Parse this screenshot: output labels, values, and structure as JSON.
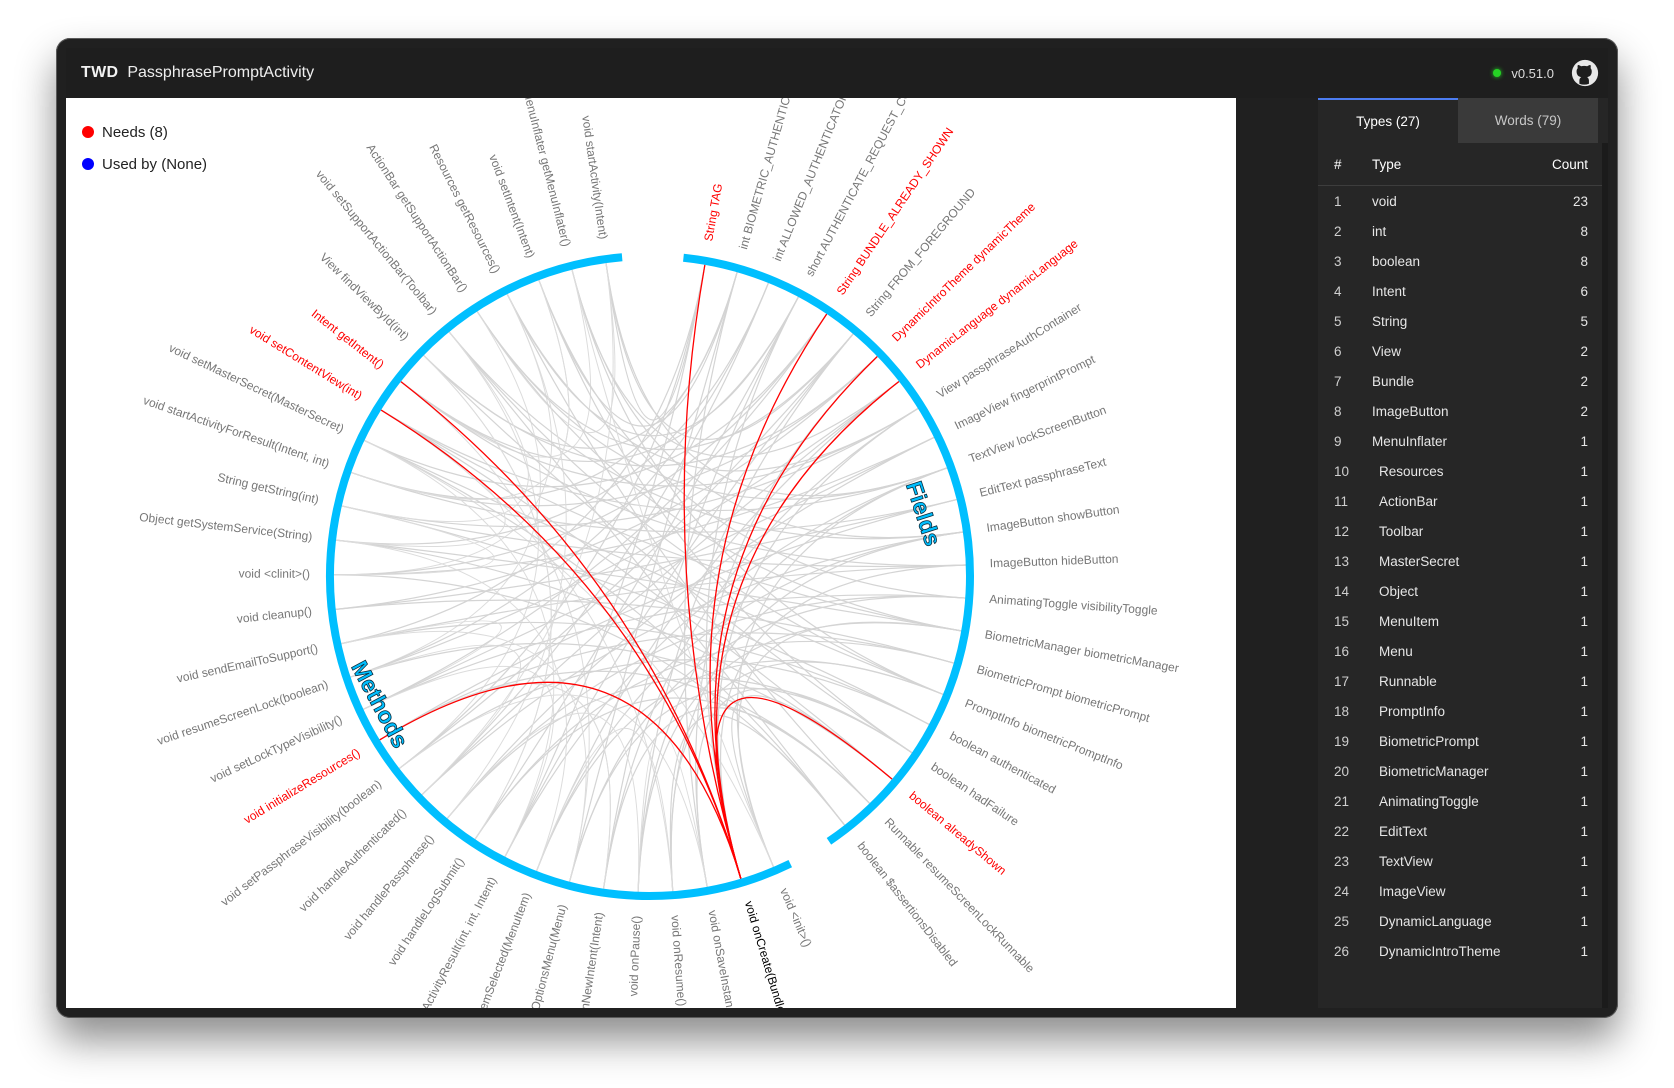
{
  "window": {
    "brand": "TWD",
    "title": "PassphrasePromptActivity",
    "version": "v0.51.0"
  },
  "legend": {
    "needs": "Needs (8)",
    "used_by": "Used by (None)",
    "needs_color": "#ff0000",
    "used_by_color": "#0000ff"
  },
  "graph": {
    "methods_label": "Methods",
    "fields_label": "Fields",
    "arc_color": "#00bfff",
    "selected": "void onCreate(Bundle)",
    "methods": [
      {
        "label": "void startActivity(Intent)",
        "needs": false
      },
      {
        "label": "MenuInflater getMenuInflater()",
        "needs": false
      },
      {
        "label": "void setIntent(Intent)",
        "needs": false
      },
      {
        "label": "Resources getResources()",
        "needs": false
      },
      {
        "label": "ActionBar getSupportActionBar()",
        "needs": false
      },
      {
        "label": "void setSupportActionBar(Toolbar)",
        "needs": false
      },
      {
        "label": "View findViewById(int)",
        "needs": false
      },
      {
        "label": "Intent getIntent()",
        "needs": true
      },
      {
        "label": "void setContentView(int)",
        "needs": true
      },
      {
        "label": "void setMasterSecret(MasterSecret)",
        "needs": false
      },
      {
        "label": "void startActivityForResult(Intent, int)",
        "needs": false
      },
      {
        "label": "String getString(int)",
        "needs": false
      },
      {
        "label": "Object getSystemService(String)",
        "needs": false
      },
      {
        "label": "void <clinit>()",
        "needs": false
      },
      {
        "label": "void cleanup()",
        "needs": false
      },
      {
        "label": "void sendEmailToSupport()",
        "needs": false
      },
      {
        "label": "void resumeScreenLock(boolean)",
        "needs": false
      },
      {
        "label": "void setLockTypeVisibility()",
        "needs": false
      },
      {
        "label": "void initializeResources()",
        "needs": true
      },
      {
        "label": "void setPassphraseVisibility(boolean)",
        "needs": false
      },
      {
        "label": "void handleAuthenticated()",
        "needs": false
      },
      {
        "label": "void handlePassphrase()",
        "needs": false
      },
      {
        "label": "void handleLogSubmit()",
        "needs": false
      },
      {
        "label": "void onActivityResult(int, int, Intent)",
        "needs": false
      },
      {
        "label": "boolean onOptionsItemSelected(MenuItem)",
        "needs": false
      },
      {
        "label": "boolean onCreateOptionsMenu(Menu)",
        "needs": false
      },
      {
        "label": "void onNewIntent(Intent)",
        "needs": false
      },
      {
        "label": "void onPause()",
        "needs": false
      },
      {
        "label": "void onResume()",
        "needs": false
      },
      {
        "label": "void onSaveInstanceState(Bundle)",
        "needs": false
      },
      {
        "label": "void onCreate(Bundle)",
        "needs": false
      },
      {
        "label": "void <init>()",
        "needs": false
      }
    ],
    "fields": [
      {
        "label": "String TAG",
        "needs": true
      },
      {
        "label": "int BIOMETRIC_AUTHENTICATORS",
        "needs": false
      },
      {
        "label": "int ALLOWED_AUTHENTICATORS",
        "needs": false
      },
      {
        "label": "short AUTHENTICATE_REQUEST_CODE",
        "needs": false
      },
      {
        "label": "String BUNDLE_ALREADY_SHOWN",
        "needs": true
      },
      {
        "label": "String FROM_FOREGROUND",
        "needs": false
      },
      {
        "label": "DynamicIntroTheme dynamicTheme",
        "needs": true
      },
      {
        "label": "DynamicLanguage dynamicLanguage",
        "needs": true
      },
      {
        "label": "View passphraseAuthContainer",
        "needs": false
      },
      {
        "label": "ImageView fingerprintPrompt",
        "needs": false
      },
      {
        "label": "TextView lockScreenButton",
        "needs": false
      },
      {
        "label": "EditText passphraseText",
        "needs": false
      },
      {
        "label": "ImageButton showButton",
        "needs": false
      },
      {
        "label": "ImageButton hideButton",
        "needs": false
      },
      {
        "label": "AnimatingToggle visibilityToggle",
        "needs": false
      },
      {
        "label": "BiometricManager biometricManager",
        "needs": false
      },
      {
        "label": "BiometricPrompt biometricPrompt",
        "needs": false
      },
      {
        "label": "PromptInfo biometricPromptInfo",
        "needs": false
      },
      {
        "label": "boolean authenticated",
        "needs": false
      },
      {
        "label": "boolean hadFailure",
        "needs": false
      },
      {
        "label": "boolean alreadyShown",
        "needs": true
      },
      {
        "label": "Runnable resumeScreenLockRunnable",
        "needs": false
      },
      {
        "label": "boolean $assertionsDisabled",
        "needs": false
      }
    ]
  },
  "sidebar": {
    "tabs": [
      "Types (27)",
      "Words (79)"
    ],
    "headers": {
      "num": "#",
      "type": "Type",
      "count": "Count"
    },
    "rows": [
      {
        "num": "1",
        "type": "void",
        "count": "23"
      },
      {
        "num": "2",
        "type": "int",
        "count": "8"
      },
      {
        "num": "3",
        "type": "boolean",
        "count": "8"
      },
      {
        "num": "4",
        "type": "Intent",
        "count": "6"
      },
      {
        "num": "5",
        "type": "String",
        "count": "5"
      },
      {
        "num": "6",
        "type": "View",
        "count": "2"
      },
      {
        "num": "7",
        "type": "Bundle",
        "count": "2"
      },
      {
        "num": "8",
        "type": "ImageButton",
        "count": "2"
      },
      {
        "num": "9",
        "type": "MenuInflater",
        "count": "1"
      },
      {
        "num": "10",
        "type": "Resources",
        "count": "1"
      },
      {
        "num": "11",
        "type": "ActionBar",
        "count": "1"
      },
      {
        "num": "12",
        "type": "Toolbar",
        "count": "1"
      },
      {
        "num": "13",
        "type": "MasterSecret",
        "count": "1"
      },
      {
        "num": "14",
        "type": "Object",
        "count": "1"
      },
      {
        "num": "15",
        "type": "MenuItem",
        "count": "1"
      },
      {
        "num": "16",
        "type": "Menu",
        "count": "1"
      },
      {
        "num": "17",
        "type": "Runnable",
        "count": "1"
      },
      {
        "num": "18",
        "type": "PromptInfo",
        "count": "1"
      },
      {
        "num": "19",
        "type": "BiometricPrompt",
        "count": "1"
      },
      {
        "num": "20",
        "type": "BiometricManager",
        "count": "1"
      },
      {
        "num": "21",
        "type": "AnimatingToggle",
        "count": "1"
      },
      {
        "num": "22",
        "type": "EditText",
        "count": "1"
      },
      {
        "num": "23",
        "type": "TextView",
        "count": "1"
      },
      {
        "num": "24",
        "type": "ImageView",
        "count": "1"
      },
      {
        "num": "25",
        "type": "DynamicLanguage",
        "count": "1"
      },
      {
        "num": "26",
        "type": "DynamicIntroTheme",
        "count": "1"
      }
    ]
  }
}
